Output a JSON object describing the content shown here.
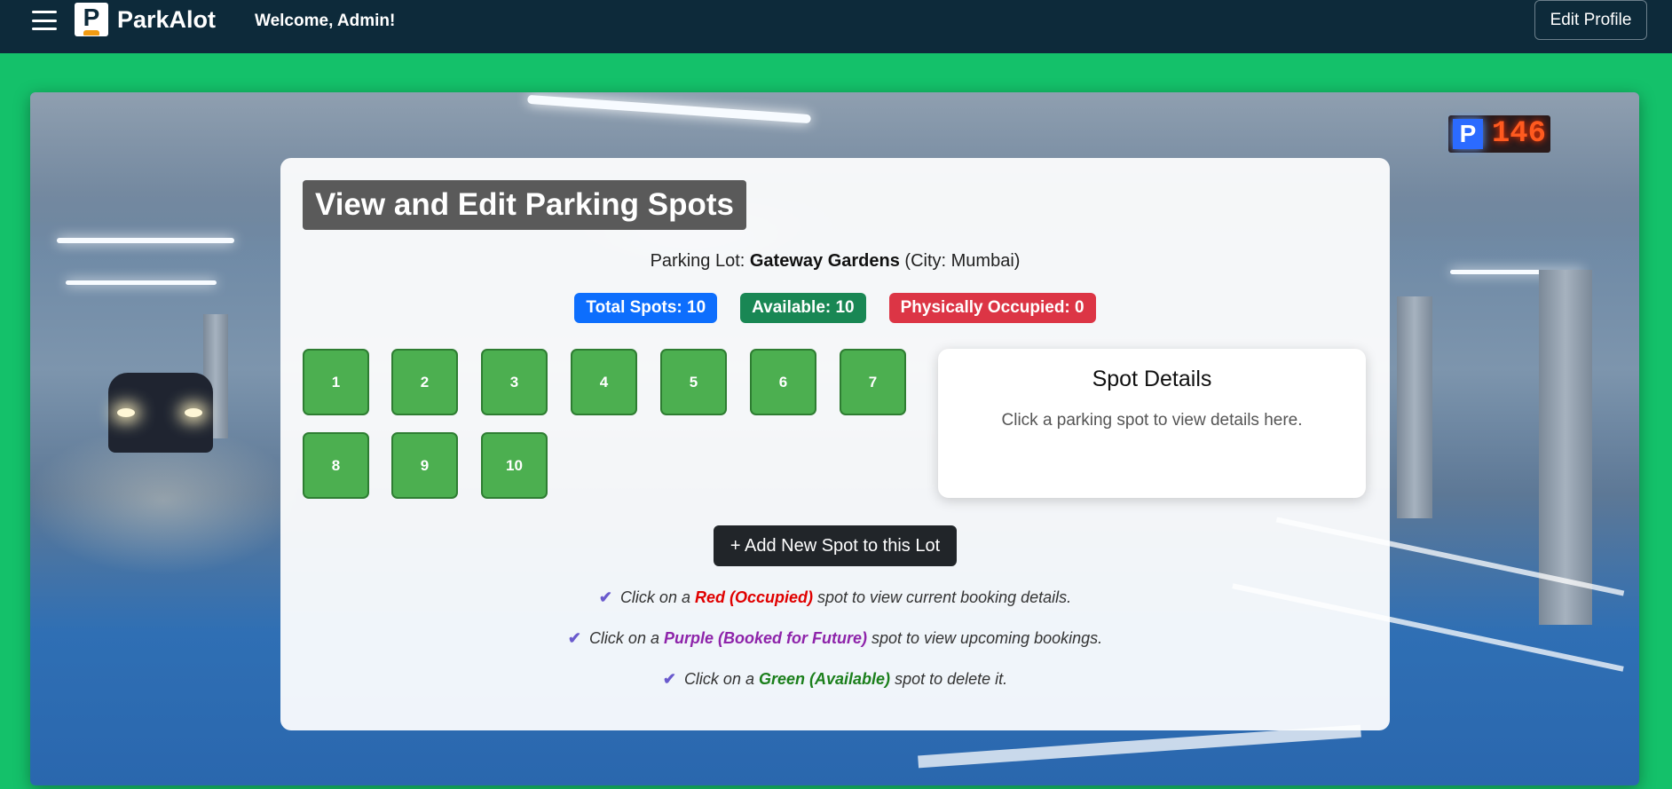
{
  "navbar": {
    "brand": "ParkAlot",
    "welcome": "Welcome, Admin!",
    "edit_profile": "Edit Profile"
  },
  "sign": {
    "letter": "P",
    "number": "146"
  },
  "card": {
    "title": "View and Edit Parking Spots",
    "lot_prefix": "Parking Lot:",
    "lot_name": "Gateway Gardens",
    "lot_city": "(City: Mumbai)",
    "badges": {
      "total": "Total Spots: 10",
      "available": "Available: 10",
      "occupied": "Physically Occupied: 0"
    },
    "spots": [
      "1",
      "2",
      "3",
      "4",
      "5",
      "6",
      "7",
      "8",
      "9",
      "10"
    ],
    "details": {
      "title": "Spot Details",
      "text": "Click a parking spot to view details here."
    },
    "add_button": "+ Add New Spot to this Lot",
    "hints": {
      "red": {
        "pre": "Click on a",
        "key": "Red (Occupied)",
        "post": "spot to view current booking details."
      },
      "purple": {
        "pre": "Click on a",
        "key": "Purple (Booked for Future)",
        "post": "spot to view upcoming bookings."
      },
      "green": {
        "pre": "Click on a",
        "key": "Green (Available)",
        "post": "spot to delete it."
      }
    }
  },
  "colors": {
    "page_bg": "#14c16a",
    "navbar_bg": "#0d2a3a",
    "spot_available": "#4caf50",
    "badge_total": "#0d6efd",
    "badge_available": "#198754",
    "badge_occupied": "#dc3545"
  }
}
